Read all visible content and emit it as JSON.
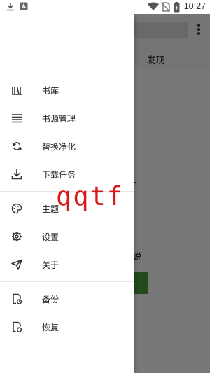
{
  "status_bar": {
    "time": "10:27",
    "icons": [
      "download-icon",
      "app-notification-icon",
      "wifi-icon",
      "no-sim-icon",
      "battery-icon"
    ],
    "battery_level": "82"
  },
  "background_app": {
    "tab_label": "发现",
    "partial_text": "说",
    "accent": "#4a9a3c"
  },
  "drawer": {
    "groups": [
      {
        "items": [
          {
            "label": "书库",
            "icon": "bookshelf-icon"
          },
          {
            "label": "书源管理",
            "icon": "list-icon"
          },
          {
            "label": "替换净化",
            "icon": "replace-icon"
          },
          {
            "label": "下载任务",
            "icon": "download-task-icon"
          }
        ]
      },
      {
        "items": [
          {
            "label": "主题",
            "icon": "palette-icon"
          },
          {
            "label": "设置",
            "icon": "settings-icon"
          },
          {
            "label": "关于",
            "icon": "send-icon"
          }
        ]
      },
      {
        "items": [
          {
            "label": "备份",
            "icon": "backup-icon"
          },
          {
            "label": "恢复",
            "icon": "restore-icon"
          }
        ]
      }
    ]
  },
  "overlay_text": "qqtf"
}
